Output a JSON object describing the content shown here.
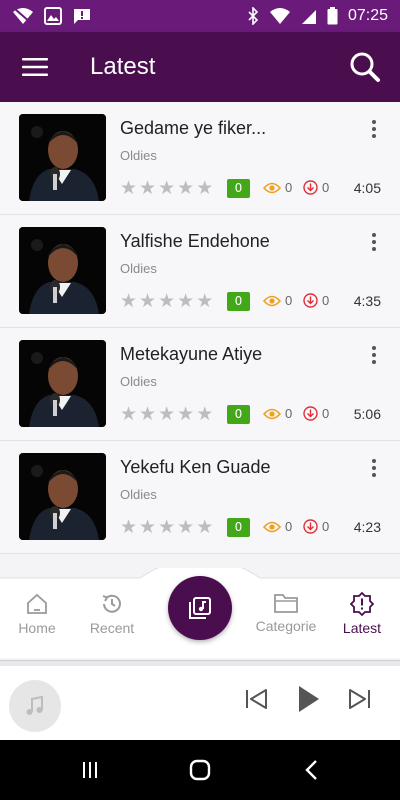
{
  "status_bar": {
    "time": "07:25"
  },
  "app_bar": {
    "title": "Latest"
  },
  "songs": [
    {
      "title": "Gedame ye fiker...",
      "category": "Oldies",
      "rating": "0",
      "views": "0",
      "downloads": "0",
      "duration": "4:05"
    },
    {
      "title": "Yalfishe Endehone",
      "category": "Oldies",
      "rating": "0",
      "views": "0",
      "downloads": "0",
      "duration": "4:35"
    },
    {
      "title": "Metekayune Atiye",
      "category": "Oldies",
      "rating": "0",
      "views": "0",
      "downloads": "0",
      "duration": "5:06"
    },
    {
      "title": "Yekefu Ken Guade",
      "category": "Oldies",
      "rating": "0",
      "views": "0",
      "downloads": "0",
      "duration": "4:23"
    }
  ],
  "bottom_nav": {
    "items": [
      {
        "label": "Home",
        "icon": "home-icon"
      },
      {
        "label": "Recent",
        "icon": "history-icon"
      },
      {
        "label": "Categorie",
        "icon": "folder-icon"
      },
      {
        "label": "Latest",
        "icon": "alert-badge-icon"
      }
    ],
    "active": "Latest"
  },
  "colors": {
    "primary": "#4a0e4e",
    "status_bar": "#6a1b79",
    "badge_green": "#43a819",
    "views_orange": "#f0a020",
    "downloads_red": "#e0303a"
  }
}
